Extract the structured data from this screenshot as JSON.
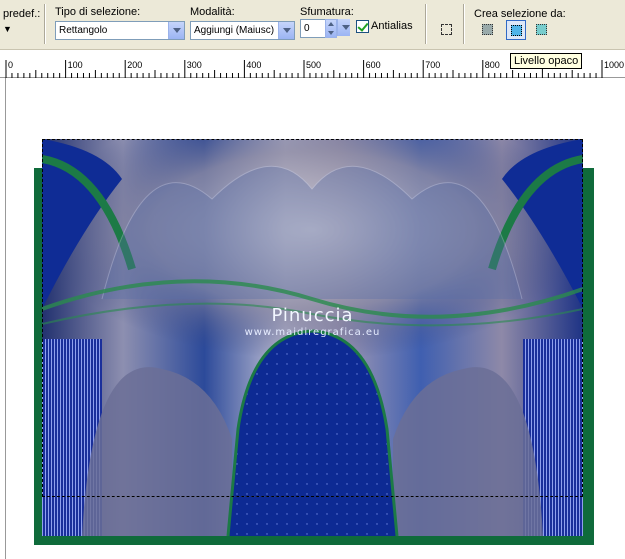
{
  "toolbar": {
    "preset_label": "predef.:",
    "selection_type": {
      "label": "Tipo di selezione:",
      "value": "Rettangolo"
    },
    "mode": {
      "label": "Modalità:",
      "value": "Aggiungi (Maiusc)"
    },
    "feather": {
      "label": "Sfumatura:",
      "value": "0"
    },
    "antialias": {
      "label": "Antialias",
      "checked": true
    },
    "create_selection": {
      "label": "Crea selezione da:",
      "active_tool_tooltip": "Livello opaco"
    }
  },
  "ruler": {
    "labels": [
      "0",
      "100",
      "200",
      "300",
      "400",
      "500",
      "600",
      "700",
      "800",
      "900",
      "1000"
    ]
  },
  "canvas": {
    "watermark_title": "Pinuccia",
    "watermark_url": "www.maidiregrafica.eu"
  },
  "colors": {
    "frame_green": "#0f6b3b",
    "deep_blue": "#1a2a7a",
    "toolbar_bg": "#ece9d8"
  }
}
